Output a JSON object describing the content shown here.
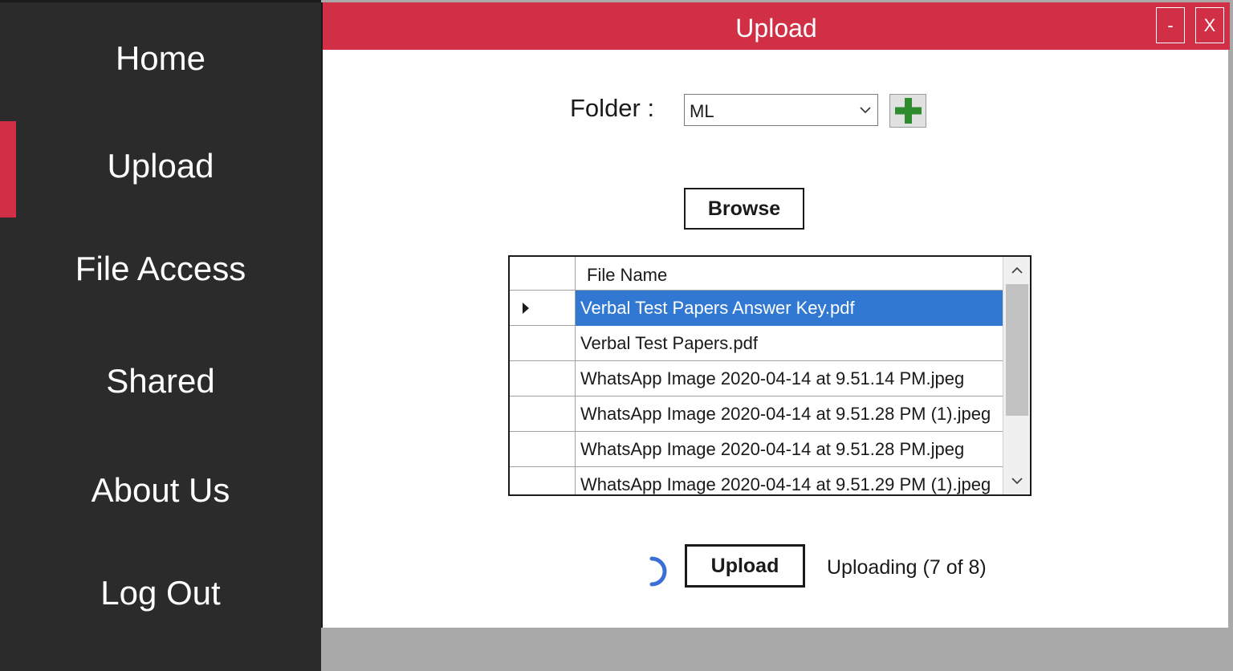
{
  "sidebar": {
    "items": [
      {
        "label": "Home"
      },
      {
        "label": "Upload"
      },
      {
        "label": "File Access"
      },
      {
        "label": "Shared"
      },
      {
        "label": "About Us"
      },
      {
        "label": "Log Out"
      }
    ],
    "active": "Upload"
  },
  "window": {
    "title": "Upload",
    "minimize_label": "-",
    "close_label": "X"
  },
  "folder": {
    "label": "Folder :",
    "selected": "ML"
  },
  "browse_label": "Browse",
  "grid": {
    "column_header": "File Name",
    "rows": [
      "Verbal Test Papers Answer Key.pdf",
      "Verbal Test Papers.pdf",
      "WhatsApp Image 2020-04-14 at 9.51.14 PM.jpeg",
      "WhatsApp Image 2020-04-14 at 9.51.28 PM (1).jpeg",
      "WhatsApp Image 2020-04-14 at 9.51.28 PM.jpeg",
      "WhatsApp Image 2020-04-14 at 9.51.29 PM (1).jpeg"
    ],
    "selected_row": 0
  },
  "upload_label": "Upload",
  "status": "Uploading (7 of 8)",
  "colors": {
    "accent": "#d12f45",
    "sidebar_bg": "#2c2b2c",
    "selection": "#3178d2",
    "spinner": "#3b6fd6",
    "add_icon": "#2e8b2e"
  }
}
